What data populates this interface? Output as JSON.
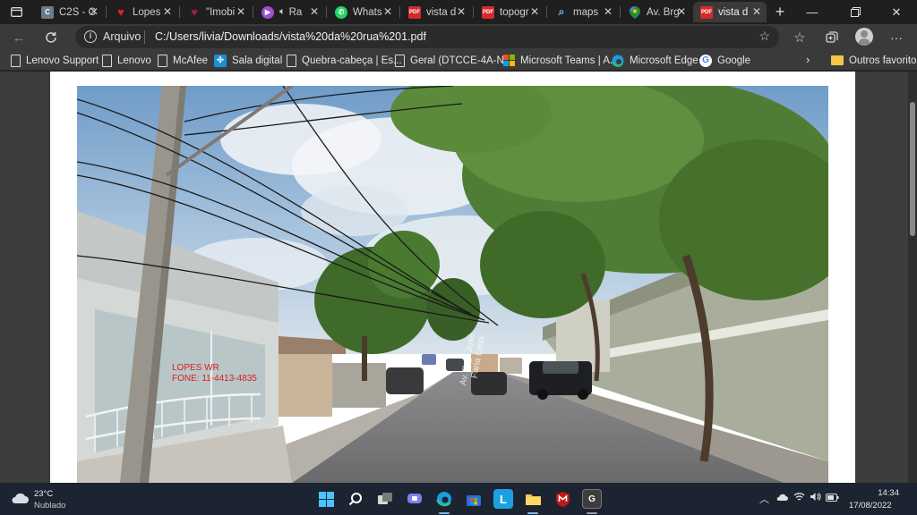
{
  "tabs": [
    {
      "title": "C2S - C",
      "favicon": "c2s-icon",
      "color": "#6b7b8c",
      "letter": "C"
    },
    {
      "title": "Lopes",
      "favicon": "heart-icon",
      "color": "#e02020",
      "letter": "♥"
    },
    {
      "title": "\"Imobi",
      "favicon": "heart-icon",
      "color": "#a0203c",
      "letter": "♥"
    },
    {
      "title": "Ra",
      "favicon": "media-icon",
      "color": "#9a4fd0",
      "letter": "▶"
    },
    {
      "title": "Whats",
      "favicon": "whatsapp-icon",
      "color": "#25d366",
      "letter": "✆"
    },
    {
      "title": "vista d",
      "favicon": "pdf-icon",
      "color": "#d62a2a",
      "letter": "PDF"
    },
    {
      "title": "topogr",
      "favicon": "pdf-icon",
      "color": "#d62a2a",
      "letter": "PDF"
    },
    {
      "title": "maps",
      "favicon": "search-icon",
      "color": "#2b2b2b",
      "letter": "⌕"
    },
    {
      "title": "Av. Brg",
      "favicon": "maps-pin-icon",
      "color": "#1e8e3e",
      "letter": "◆"
    },
    {
      "title": "vista d",
      "favicon": "pdf-icon",
      "color": "#d62a2a",
      "letter": "PDF"
    }
  ],
  "address": {
    "scheme_label": "Arquivo",
    "url": "C:/Users/livia/Downloads/vista%20da%20rua%201.pdf"
  },
  "bookmarks": [
    {
      "label": "Lenovo Support",
      "icon": "page-icon"
    },
    {
      "label": "Lenovo",
      "icon": "page-icon"
    },
    {
      "label": "McAfee",
      "icon": "page-icon"
    },
    {
      "label": "Sala digital",
      "icon": "sala-digital-icon"
    },
    {
      "label": "Quebra-cabeça | Es...",
      "icon": "page-icon"
    },
    {
      "label": "Geral (DTCCE-4A-N...",
      "icon": "page-icon"
    },
    {
      "label": "Microsoft Teams | A...",
      "icon": "microsoft-icon"
    },
    {
      "label": "Microsoft Edge",
      "icon": "edge-icon"
    },
    {
      "label": "Google",
      "icon": "google-icon"
    }
  ],
  "bookmarks_overflow_folder": "Outros favoritos",
  "pdf": {
    "stamp_line1": "LOPES WR",
    "stamp_line2": "FONE: 11-4413-4835",
    "road_label_line1": "Av. Brg. José",
    "road_label_line2": "Faria Lima"
  },
  "taskbar": {
    "weather_temp": "23°C",
    "weather_desc": "Nublado",
    "apps": [
      "windows-start-icon",
      "search-icon",
      "task-view-icon",
      "chat-icon",
      "edge-icon",
      "store-icon",
      "lenovo-l-icon",
      "file-explorer-icon",
      "mcafee-icon",
      "app-g-icon"
    ],
    "time": "14:34",
    "date": "17/08/2022"
  },
  "colors": {
    "accent": "#7ab8ff",
    "stamp": "#d81e1e",
    "pdf_icon": "#d62a2a"
  }
}
